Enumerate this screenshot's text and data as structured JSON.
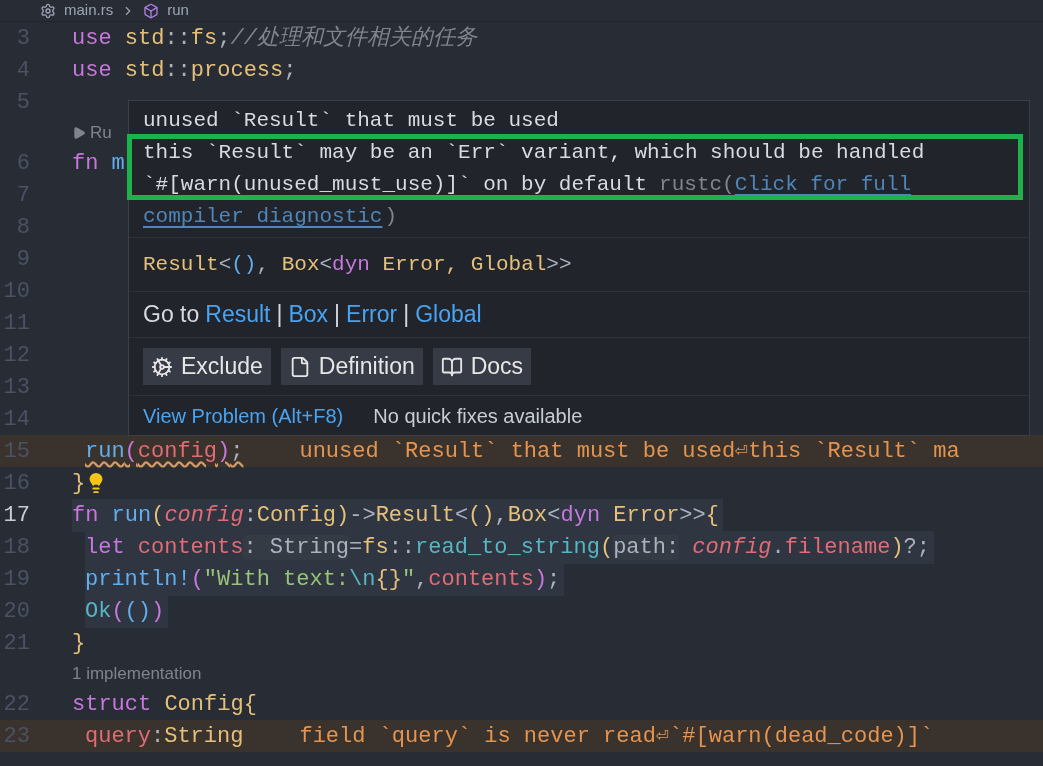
{
  "breadcrumb": {
    "file": "main.rs",
    "symbol": "run"
  },
  "rows": [
    {
      "kind": "line",
      "number": "3",
      "active": false,
      "tokens": [
        {
          "text": "use ",
          "kind": "kw"
        },
        {
          "text": "std",
          "kind": "type"
        },
        {
          "text": "::",
          "kind": "punct"
        },
        {
          "text": "fs",
          "kind": "type"
        },
        {
          "text": ";",
          "kind": "plain"
        },
        {
          "text": "//处理和文件相关的任务",
          "kind": "comment"
        }
      ]
    },
    {
      "kind": "line",
      "number": "4",
      "active": false,
      "tokens": [
        {
          "text": "use ",
          "kind": "kw"
        },
        {
          "text": "std",
          "kind": "type"
        },
        {
          "text": "::",
          "kind": "punct"
        },
        {
          "text": "process",
          "kind": "type"
        },
        {
          "text": ";",
          "kind": "plain"
        }
      ]
    },
    {
      "kind": "line",
      "number": "5",
      "active": false,
      "tokens": []
    },
    {
      "kind": "codelens",
      "label": "Ru",
      "run_icon": true
    },
    {
      "kind": "line",
      "number": "6",
      "active": false,
      "tokens": [
        {
          "text": "fn ",
          "kind": "kw"
        },
        {
          "text": "m",
          "kind": "fn"
        }
      ]
    },
    {
      "kind": "line",
      "number": "7",
      "active": false,
      "tokens": []
    },
    {
      "kind": "line",
      "number": "8",
      "active": false,
      "tokens": []
    },
    {
      "kind": "line",
      "number": "9",
      "active": false,
      "tokens": []
    },
    {
      "kind": "line",
      "number": "10",
      "active": false,
      "tokens": []
    },
    {
      "kind": "line",
      "number": "11",
      "active": false,
      "tokens": []
    },
    {
      "kind": "line",
      "number": "12",
      "active": false,
      "tokens": []
    },
    {
      "kind": "line",
      "number": "13",
      "active": false,
      "tokens": []
    },
    {
      "kind": "line",
      "number": "14",
      "active": false,
      "tokens": []
    },
    {
      "kind": "indented_line",
      "number": "15",
      "active": false,
      "warning": true,
      "squiggle": true,
      "tokens": [
        {
          "text": "run",
          "kind": "fn"
        },
        {
          "text": "(",
          "kind": "bracket"
        },
        {
          "text": "config",
          "kind": "var"
        },
        {
          "text": ")",
          "kind": "bracket"
        },
        {
          "text": ";",
          "kind": "plain"
        }
      ],
      "diagnostic": "unused `Result` that must be used⏎this `Result` ma"
    },
    {
      "kind": "line",
      "number": "16",
      "active": false,
      "lightbulb": true,
      "tokens": [
        {
          "text": "}",
          "kind": "type"
        }
      ]
    },
    {
      "kind": "line",
      "number": "17",
      "active": true,
      "highlighted": true,
      "tokens": [
        {
          "text": "fn ",
          "kind": "kw"
        },
        {
          "text": "run",
          "kind": "fn"
        },
        {
          "text": "(",
          "kind": "type"
        },
        {
          "text": "config",
          "kind": "param"
        },
        {
          "text": ":",
          "kind": "punct"
        },
        {
          "text": "Config",
          "kind": "type"
        },
        {
          "text": ")",
          "kind": "type"
        },
        {
          "text": "->",
          "kind": "punct"
        },
        {
          "text": "Result",
          "kind": "type"
        },
        {
          "text": "<",
          "kind": "punct"
        },
        {
          "text": "()",
          "kind": "type"
        },
        {
          "text": ",",
          "kind": "plain"
        },
        {
          "text": "Box",
          "kind": "type"
        },
        {
          "text": "<",
          "kind": "punct"
        },
        {
          "text": "dyn ",
          "kind": "kw"
        },
        {
          "text": "Error",
          "kind": "type"
        },
        {
          "text": ">>",
          "kind": "punct"
        },
        {
          "text": "{",
          "kind": "type"
        }
      ]
    },
    {
      "kind": "indented_line",
      "number": "18",
      "active": false,
      "highlighted": true,
      "tokens": [
        {
          "text": "let ",
          "kind": "kw"
        },
        {
          "text": "contents",
          "kind": "var"
        },
        {
          "text": ": String",
          "kind": "hint"
        },
        {
          "text": "=",
          "kind": "plain"
        },
        {
          "text": "fs",
          "kind": "type"
        },
        {
          "text": "::",
          "kind": "punct"
        },
        {
          "text": "read_to_string",
          "kind": "cyan"
        },
        {
          "text": "(",
          "kind": "type"
        },
        {
          "text": "path:",
          "kind": "hint"
        },
        {
          "text": " config",
          "kind": "param"
        },
        {
          "text": ".",
          "kind": "plain"
        },
        {
          "text": "filename",
          "kind": "var"
        },
        {
          "text": ")",
          "kind": "type"
        },
        {
          "text": "?;",
          "kind": "plain"
        }
      ]
    },
    {
      "kind": "indented_line",
      "number": "19",
      "active": false,
      "highlighted": true,
      "tokens": [
        {
          "text": "println!",
          "kind": "macro"
        },
        {
          "text": "(",
          "kind": "bracket"
        },
        {
          "text": "\"With text:",
          "kind": "str"
        },
        {
          "text": "\\n",
          "kind": "cyan"
        },
        {
          "text": "{}",
          "kind": "type"
        },
        {
          "text": "\"",
          "kind": "str"
        },
        {
          "text": ",",
          "kind": "plain"
        },
        {
          "text": "contents",
          "kind": "var"
        },
        {
          "text": ")",
          "kind": "bracket"
        },
        {
          "text": ";",
          "kind": "plain"
        }
      ]
    },
    {
      "kind": "indented_line",
      "number": "20",
      "active": false,
      "highlighted": true,
      "tokens": [
        {
          "text": "Ok",
          "kind": "cyan"
        },
        {
          "text": "(",
          "kind": "bracket"
        },
        {
          "text": "()",
          "kind": "fn"
        },
        {
          "text": ")",
          "kind": "bracket"
        }
      ]
    },
    {
      "kind": "line",
      "number": "21",
      "active": false,
      "tokens": [
        {
          "text": "}",
          "kind": "type"
        }
      ]
    },
    {
      "kind": "codelens",
      "label": "1 implementation",
      "run_icon": false
    },
    {
      "kind": "line",
      "number": "22",
      "active": false,
      "tokens": [
        {
          "text": "struct ",
          "kind": "kw"
        },
        {
          "text": "Config",
          "kind": "type"
        },
        {
          "text": "{",
          "kind": "type"
        }
      ]
    },
    {
      "kind": "indented_line",
      "number": "23",
      "active": false,
      "warning": true,
      "tokens": [
        {
          "text": "query",
          "kind": "var"
        },
        {
          "text": ":",
          "kind": "punct"
        },
        {
          "text": "String",
          "kind": "type"
        }
      ],
      "diagnostic": "field `query` is never read⏎`#[warn(dead_code)]`"
    }
  ],
  "hover": {
    "message": [
      "unused `Result` that must be used",
      "this `Result` may be an `Err` variant, which should be handled",
      "`#[warn(unused_must_use)]` on by default"
    ],
    "source": "rustc(",
    "link": [
      "Click for full",
      "compiler diagnostic"
    ],
    "link_end": ")",
    "signature": [
      {
        "text": "Result",
        "kind": "type"
      },
      {
        "text": "<",
        "kind": "punct"
      },
      {
        "text": "()",
        "kind": "fn"
      },
      {
        "text": ", ",
        "kind": "plain"
      },
      {
        "text": "Box",
        "kind": "type"
      },
      {
        "text": "<",
        "kind": "punct"
      },
      {
        "text": "dyn",
        "kind": "kw"
      },
      {
        "text": " Error, Global",
        "kind": "type"
      },
      {
        "text": ">>",
        "kind": "punct"
      }
    ],
    "goto": [
      {
        "kind": "text",
        "text": "Go to"
      },
      {
        "kind": "link",
        "text": "Result"
      },
      {
        "kind": "sep",
        "text": "|"
      },
      {
        "kind": "link",
        "text": "Box"
      },
      {
        "kind": "sep",
        "text": "|"
      },
      {
        "kind": "link",
        "text": "Error"
      },
      {
        "kind": "sep",
        "text": "|"
      },
      {
        "kind": "link",
        "text": "Global"
      }
    ],
    "actions": [
      "Exclude",
      "Definition",
      "Docs"
    ],
    "status": {
      "link": "View Problem (Alt+F8)",
      "note": "No quick fixes available"
    }
  }
}
